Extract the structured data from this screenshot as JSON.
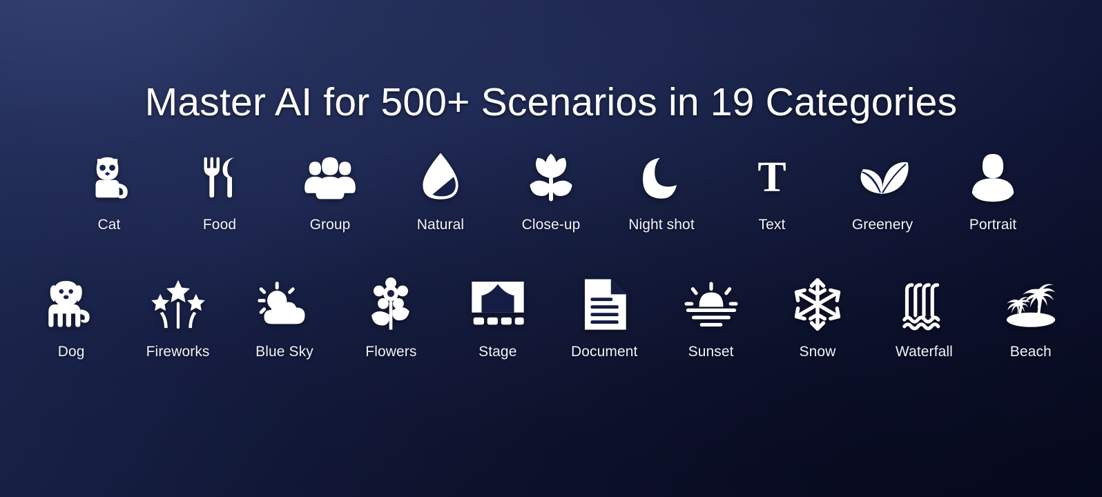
{
  "page": {
    "title": "Master AI for 500+ Scenarios in 19 Categories",
    "background_top_left": "#23305c",
    "background_bottom_right": "#080c24",
    "icon_color": "#ffffff",
    "label_color": "#f2f4fb"
  },
  "rows": [
    {
      "id": "row-1",
      "items": [
        {
          "label": "Cat",
          "icon": "cat-icon"
        },
        {
          "label": "Food",
          "icon": "fork-knife-icon"
        },
        {
          "label": "Group",
          "icon": "group-people-icon"
        },
        {
          "label": "Natural",
          "icon": "water-droplet-icon"
        },
        {
          "label": "Close-up",
          "icon": "tulip-icon"
        },
        {
          "label": "Night shot",
          "icon": "crescent-moon-icon"
        },
        {
          "label": "Text",
          "icon": "letter-t-icon"
        },
        {
          "label": "Greenery",
          "icon": "leaves-icon"
        },
        {
          "label": "Portrait",
          "icon": "person-bust-icon"
        }
      ]
    },
    {
      "id": "row-2",
      "items": [
        {
          "label": "Dog",
          "icon": "dog-icon"
        },
        {
          "label": "Fireworks",
          "icon": "fireworks-stars-icon"
        },
        {
          "label": "Blue Sky",
          "icon": "sun-cloud-icon"
        },
        {
          "label": "Flowers",
          "icon": "daisy-flower-icon"
        },
        {
          "label": "Stage",
          "icon": "stage-curtain-icon"
        },
        {
          "label": "Document",
          "icon": "document-page-icon"
        },
        {
          "label": "Sunset",
          "icon": "sunset-horizon-icon"
        },
        {
          "label": "Snow",
          "icon": "snowflake-icon"
        },
        {
          "label": "Waterfall",
          "icon": "waterfall-icon"
        },
        {
          "label": "Beach",
          "icon": "palm-island-icon"
        }
      ]
    }
  ]
}
